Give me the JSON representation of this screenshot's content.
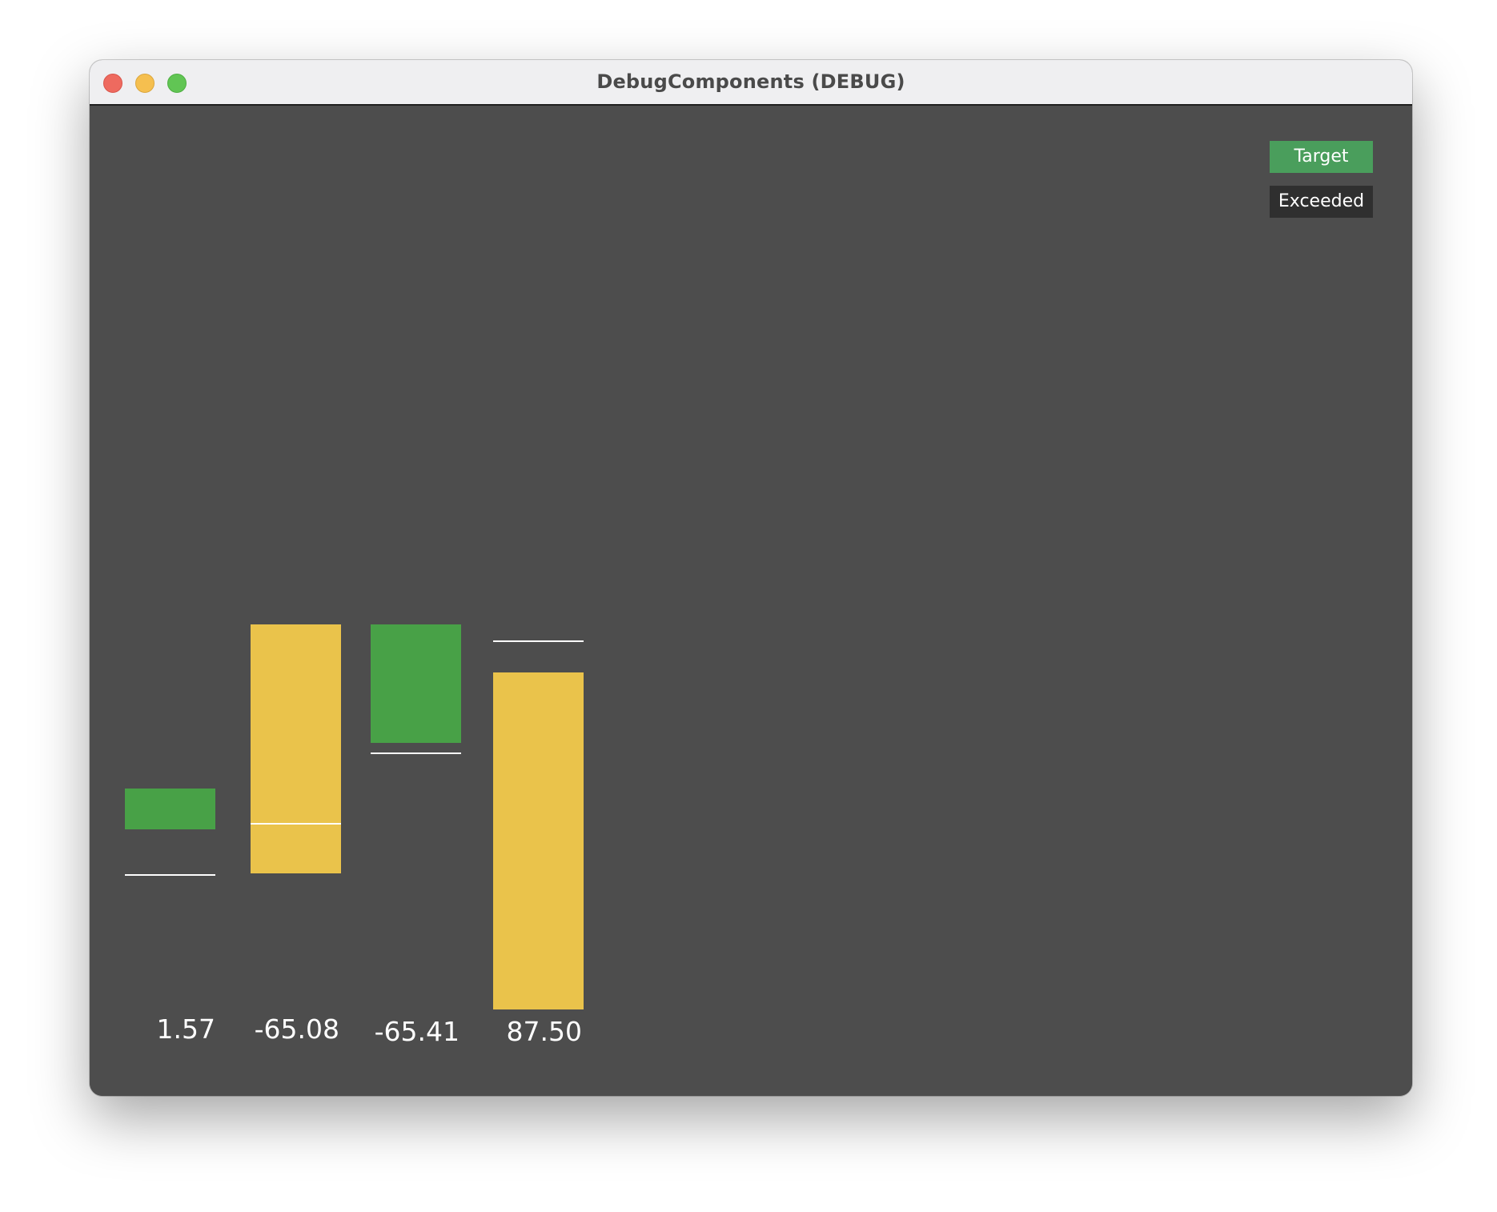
{
  "window": {
    "title": "DebugComponents (DEBUG)"
  },
  "legend": {
    "target_label": "Target",
    "exceeded_label": "Exceeded"
  },
  "colors": {
    "target": "#4a9e5c",
    "exceeded": "#2f2f2f",
    "bar_green": "#48a147",
    "bar_yellow": "#eac34b",
    "marker": "#ffffff",
    "background": "#4d4d4d"
  },
  "chart_data": {
    "type": "bar",
    "bars": [
      {
        "label": "1.57",
        "color": "green"
      },
      {
        "label": "-65.08",
        "color": "yellow"
      },
      {
        "label": "-65.41",
        "color": "green"
      },
      {
        "label": "87.50",
        "color": "yellow"
      }
    ]
  }
}
